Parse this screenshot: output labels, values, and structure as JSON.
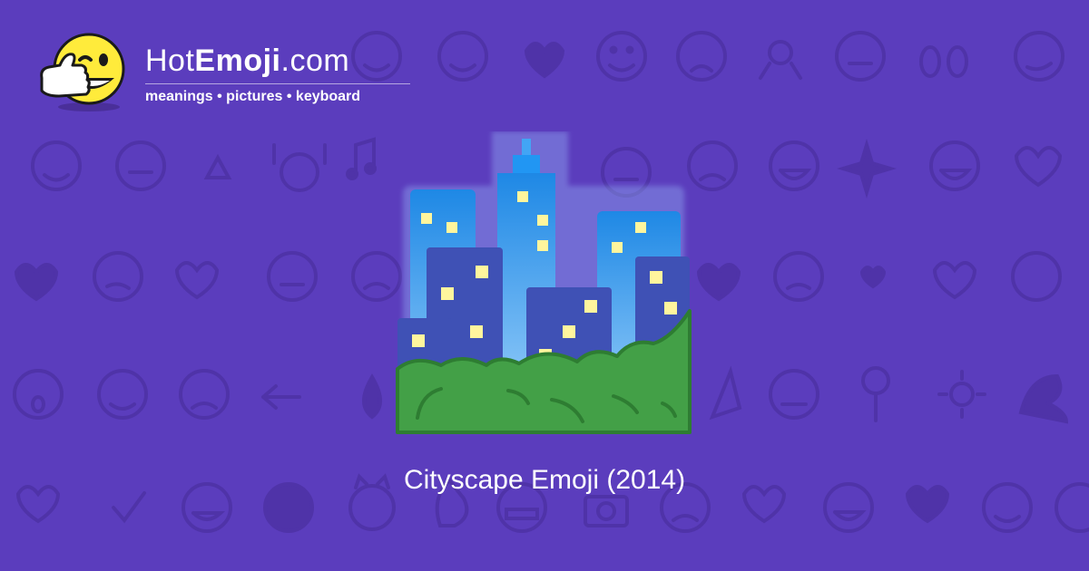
{
  "logo": {
    "name_hot": "Hot",
    "name_emoji": "Emoji",
    "name_com": ".com",
    "tagline": "meanings • pictures • keyboard",
    "mascot_icon": "winking-thumbs-up-smiley-icon"
  },
  "hero": {
    "icon": "cityscape-icon",
    "caption": "Cityscape Emoji (2014)"
  },
  "colors": {
    "background": "#5b3dbd",
    "pattern": "#4f33a8",
    "text": "#ffffff",
    "mascot_yellow": "#ffeb3b",
    "building_blue": "#3f51b5",
    "sky_blue": "#64b5f6",
    "window_yellow": "#fff59d",
    "bush_green": "#43a047"
  }
}
